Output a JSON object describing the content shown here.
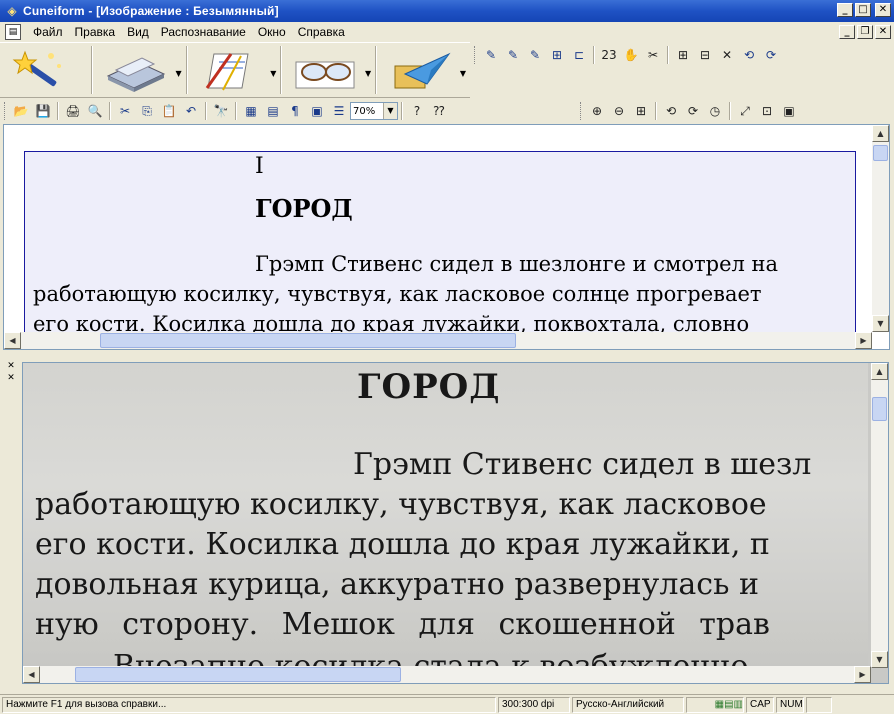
{
  "window": {
    "title": "Cuneiform - [Изображение : Безымянный]",
    "controls": [
      "_",
      "□",
      "✕"
    ]
  },
  "menu": {
    "items": [
      "Файл",
      "Правка",
      "Вид",
      "Распознавание",
      "Окно",
      "Справка"
    ],
    "mdi_controls": [
      "_",
      "❐",
      "✕"
    ]
  },
  "toolbar_big": [
    {
      "name": "magic-wand",
      "glyph": "✨"
    },
    {
      "name": "scanner",
      "glyph": "🖨"
    },
    {
      "name": "layout-editor",
      "glyph": "📐"
    },
    {
      "name": "glasses-recognize",
      "glyph": "👓"
    },
    {
      "name": "send-export",
      "glyph": "✈"
    }
  ],
  "toolbar_layout": [
    "✎",
    "✎",
    "✎",
    "⊞",
    "⊏",
    "23",
    "✋",
    "✂",
    "⊞",
    "⊟",
    "✕",
    "⟲",
    "⟳"
  ],
  "toolbar_std": [
    "📂",
    "💾",
    "🖨",
    "🔍",
    "✂",
    "⎘",
    "📋",
    "↶",
    "🔭",
    "▦",
    "▤",
    "¶",
    "▣",
    "☰"
  ],
  "zoom": {
    "value": "70%"
  },
  "toolbar_help": [
    "?",
    "⁇"
  ],
  "toolbar_view": [
    "⊕",
    "⊖",
    "⊞",
    "⟲",
    "⟳",
    "◷",
    "⤢",
    "⊡",
    "▣"
  ],
  "recognized_text": {
    "lines": [
      "I",
      "ГОРОД",
      "Грэмп Стивенс сидел в шезлонге и смотрел на",
      "работающую косилку, чувствуя, как ласковое солнце прогревает",
      "его кости. Косилка дошла до края лужайки, поквохтала, словно"
    ]
  },
  "scanned_image": {
    "lines": [
      "ГОРОД",
      "Грэмп Стивенс сидел в шезл",
      "работающую косилку, чувствуя, как ласковое",
      "его кости. Косилка дошла до края лужайки, п",
      "довольная курица, аккуратно развернулась и",
      "ную сторону. Мешок для скошенной трав",
      "Внезапно косилка стала к возбужденно"
    ]
  },
  "status": {
    "help": "Нажмите F1 для вызова справки...",
    "dpi": "300:300 dpi",
    "language": "Русско-Английский",
    "cap": "CAP",
    "num": "NUM"
  }
}
